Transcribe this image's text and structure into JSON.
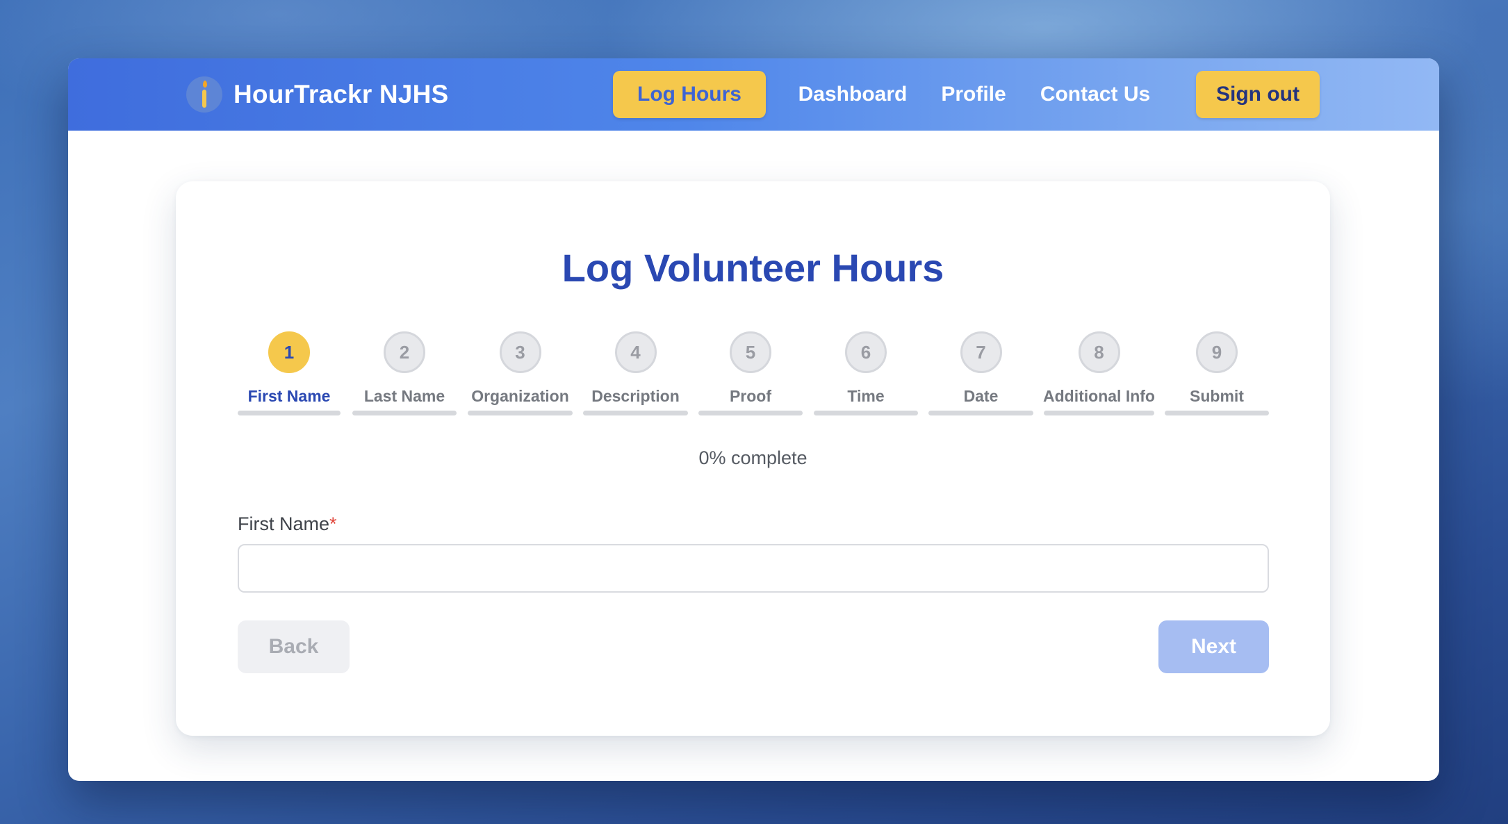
{
  "brand": {
    "name": "HourTrackr NJHS",
    "logo_icon": "candle-icon"
  },
  "nav": {
    "log_hours": "Log Hours",
    "dashboard": "Dashboard",
    "profile": "Profile",
    "contact_us": "Contact Us",
    "sign_out": "Sign out"
  },
  "form": {
    "title": "Log Volunteer Hours",
    "steps": [
      {
        "number": "1",
        "label": "First Name",
        "active": true
      },
      {
        "number": "2",
        "label": "Last Name",
        "active": false
      },
      {
        "number": "3",
        "label": "Organization",
        "active": false
      },
      {
        "number": "4",
        "label": "Description",
        "active": false
      },
      {
        "number": "5",
        "label": "Proof",
        "active": false
      },
      {
        "number": "6",
        "label": "Time",
        "active": false
      },
      {
        "number": "7",
        "label": "Date",
        "active": false
      },
      {
        "number": "8",
        "label": "Additional Info",
        "active": false
      },
      {
        "number": "9",
        "label": "Submit",
        "active": false
      }
    ],
    "progress_text": "0% complete",
    "progress_value": 0,
    "field_label": "First Name",
    "required_marker": "*",
    "field_value": "",
    "back_label": "Back",
    "next_label": "Next"
  },
  "colors": {
    "accent_yellow": "#f5c84c",
    "primary_blue": "#2a48b2",
    "nav_gradient_start": "#3f6ddd",
    "next_disabled": "#a6bdf2"
  }
}
